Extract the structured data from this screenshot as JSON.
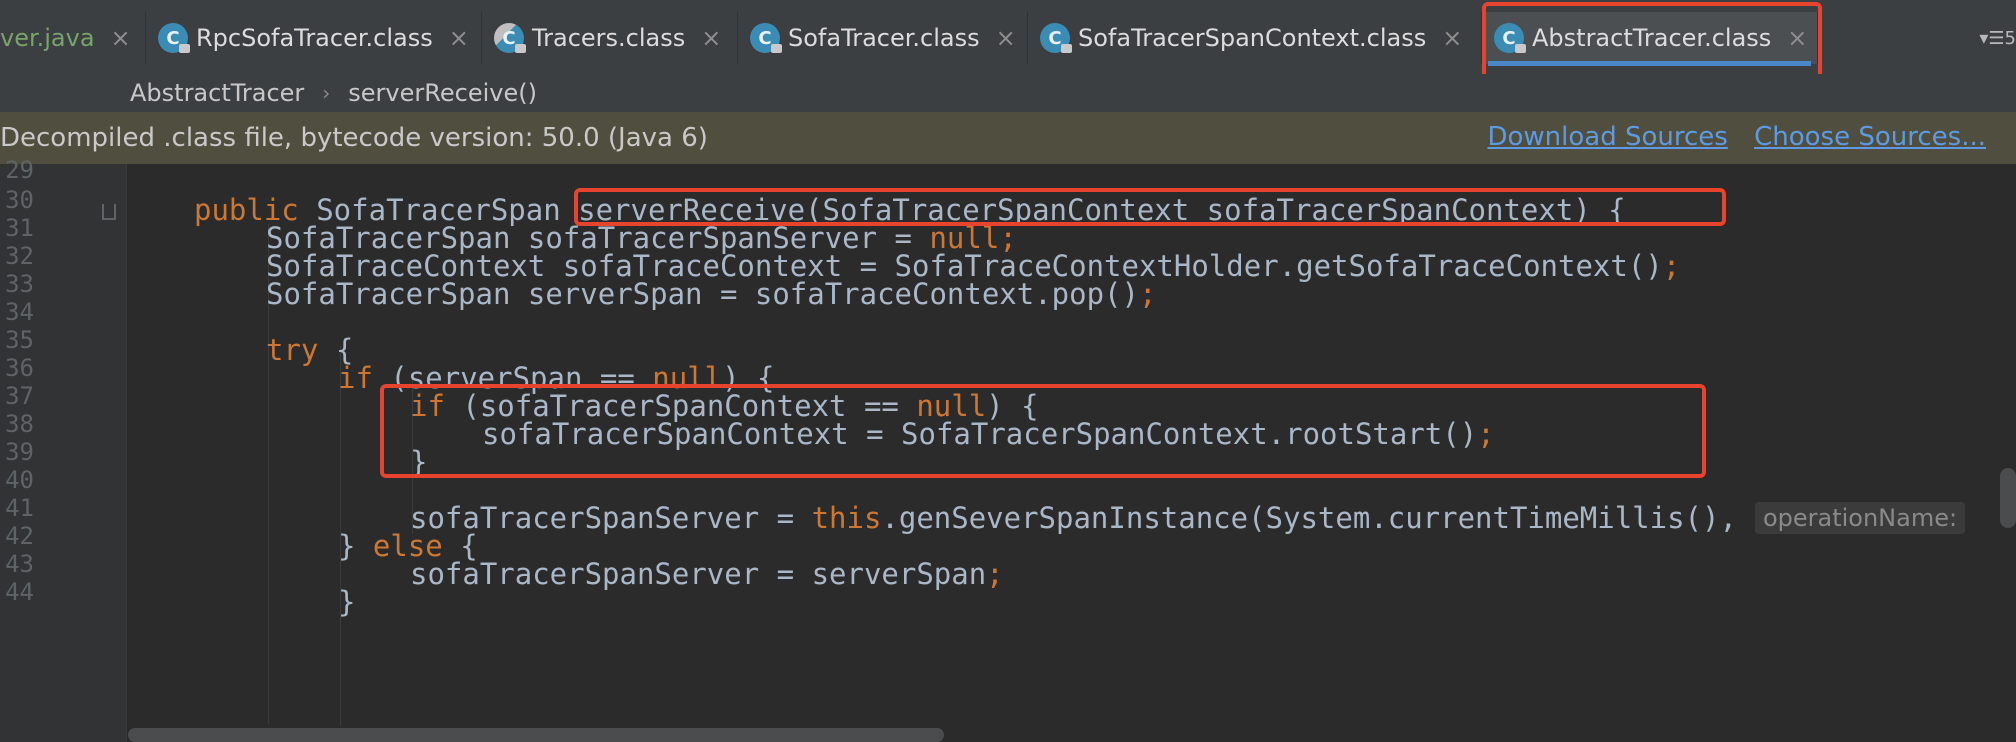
{
  "tabs": [
    {
      "label": "ver.java",
      "partial": true
    },
    {
      "label": "RpcSofaTracer.class"
    },
    {
      "label": "Tracers.class"
    },
    {
      "label": "SofaTracer.class"
    },
    {
      "label": "SofaTracerSpanContext.class"
    },
    {
      "label": "AbstractTracer.class",
      "active": true
    }
  ],
  "tab_icon_letter": "C",
  "tab_close_glyph": "×",
  "tab_menu_label": "▾☰5",
  "breadcrumb": {
    "class_name": "AbstractTracer",
    "separator": "›",
    "method_name": "serverReceive()"
  },
  "banner": {
    "text": "Decompiled .class file, bytecode version: 50.0 (Java 6)",
    "download_link": "Download Sources",
    "choose_link": "Choose Sources..."
  },
  "line_numbers": [
    "29",
    "30",
    "31",
    "32",
    "33",
    "34",
    "35",
    "36",
    "37",
    "38",
    "39",
    "40",
    "41",
    "42",
    "43",
    "44"
  ],
  "code": {
    "l130_kw": "public",
    "l130_rest": " SofaTracerSpan serverReceive(SofaTracerSpanContext sofaTracerSpanContext) {",
    "l131_a": "SofaTracerSpan sofaTracerSpanServer = ",
    "l131_null": "null",
    "l131_semi": ";",
    "l132_a": "SofaTraceContext sofaTraceContext = SofaTraceContextHolder.getSofaTraceContext()",
    "l132_semi": ";",
    "l133_a": "SofaTracerSpan serverSpan = sofaTraceContext.pop()",
    "l133_semi": ";",
    "l135_kw": "try",
    "l135_rest": " {",
    "l136_kw": "if",
    "l136_a": " (serverSpan == ",
    "l136_null": "null",
    "l136_b": ") {",
    "l137_kw": "if",
    "l137_a": " (sofaTracerSpanContext == ",
    "l137_null": "null",
    "l137_b": ") {",
    "l138_a": "sofaTracerSpanContext = SofaTracerSpanContext.rootStart()",
    "l138_semi": ";",
    "l139": "}",
    "l141_a": "sofaTracerSpanServer = ",
    "l141_this": "this",
    "l141_b": ".genSeverSpanInstance(System.currentTimeMillis(),",
    "l141_hint": "operationName:",
    "l142_a": "} ",
    "l142_kw": "else",
    "l142_b": " {",
    "l143_a": "sofaTracerSpanServer = serverSpan",
    "l143_semi": ";",
    "l144": "}"
  },
  "colors": {
    "keyword": "#cc7832",
    "text": "#a9b7c6",
    "highlight_box": "#e8432c",
    "link": "#5c9be4"
  }
}
